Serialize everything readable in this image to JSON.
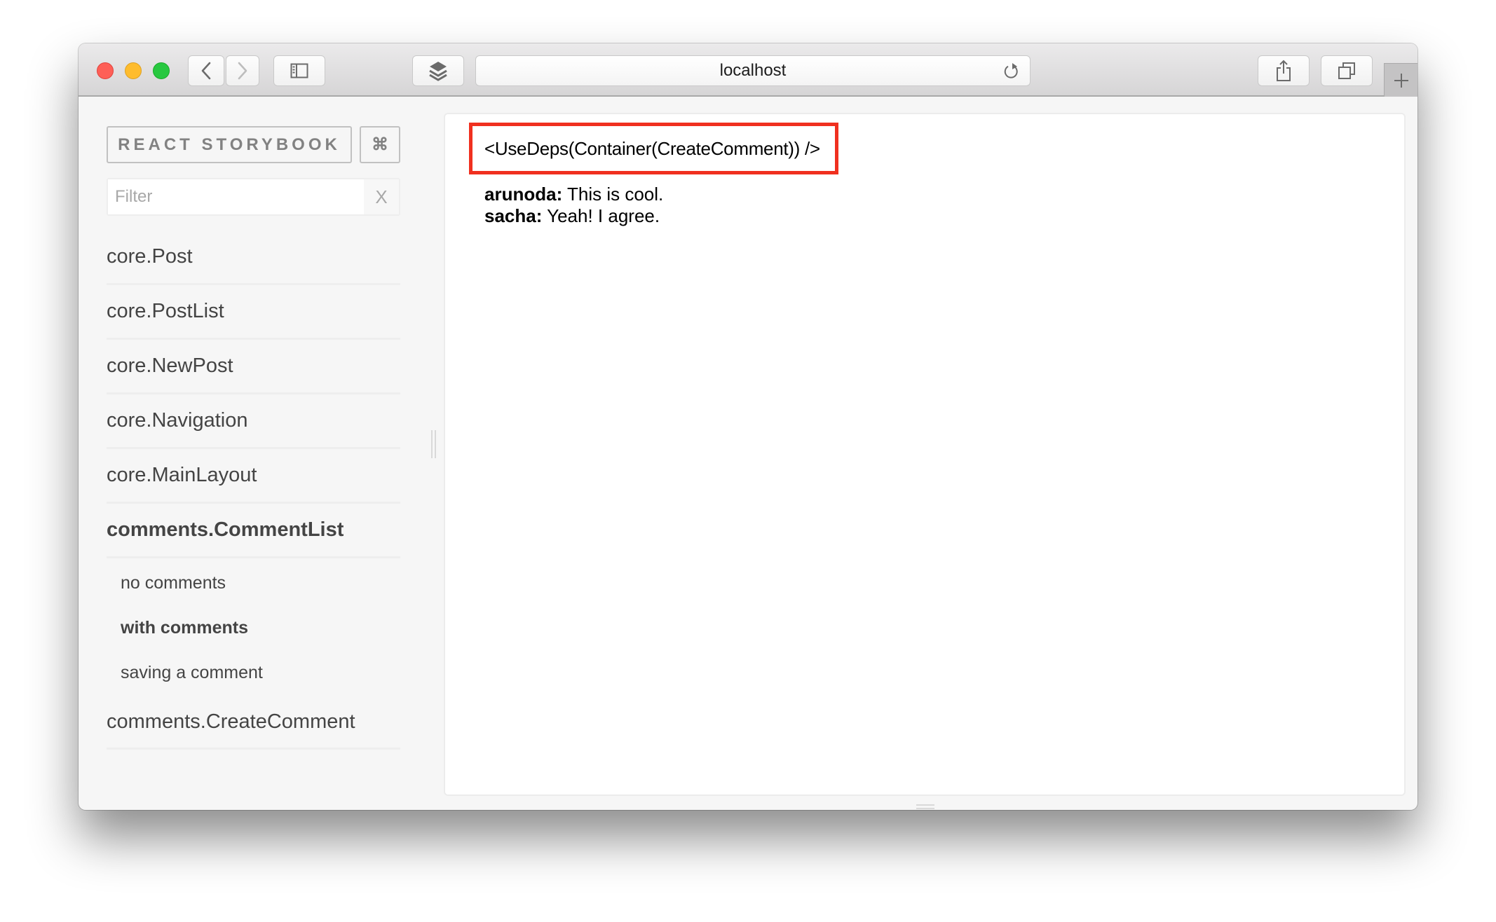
{
  "browser": {
    "url": "localhost",
    "buttons": {
      "back": "back-icon",
      "forward": "forward-icon",
      "sidebar": "sidebar-icon",
      "extensions": "layers-icon",
      "reload": "reload-icon",
      "share": "share-icon",
      "tabs": "tabs-icon",
      "new_tab": "plus-icon"
    }
  },
  "sidebar": {
    "brand_label": "REACT STORYBOOK",
    "shortcuts_label": "⌘",
    "filter": {
      "placeholder": "Filter",
      "value": "",
      "clear_label": "X"
    },
    "kinds": [
      {
        "label": "core.Post",
        "active": false
      },
      {
        "label": "core.PostList",
        "active": false
      },
      {
        "label": "core.NewPost",
        "active": false
      },
      {
        "label": "core.Navigation",
        "active": false
      },
      {
        "label": "core.MainLayout",
        "active": false
      },
      {
        "label": "comments.CommentList",
        "active": true,
        "stories": [
          {
            "label": "no comments",
            "active": false
          },
          {
            "label": "with comments",
            "active": true
          },
          {
            "label": "saving a comment",
            "active": false
          }
        ]
      },
      {
        "label": "comments.CreateComment",
        "active": false
      }
    ]
  },
  "preview": {
    "component_label": "<UseDeps(Container(CreateComment)) />",
    "highlight_color": "#f0301f",
    "comments": [
      {
        "author": "arunoda:",
        "text": " This is cool."
      },
      {
        "author": "sacha:",
        "text": " Yeah! I agree."
      }
    ]
  }
}
